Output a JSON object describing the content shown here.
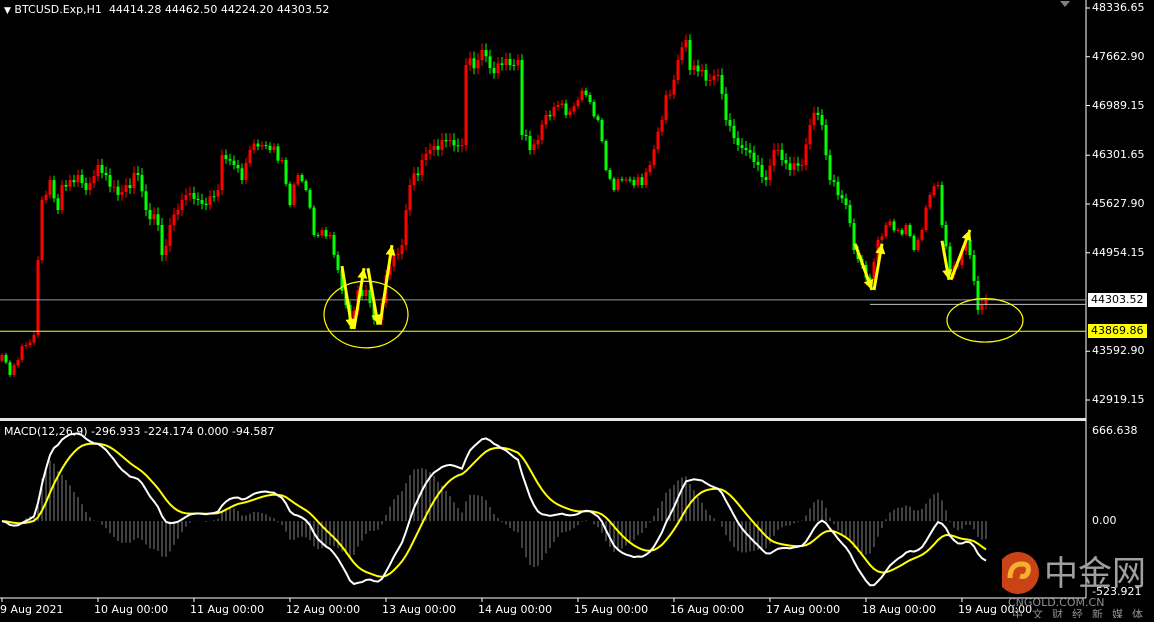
{
  "header": {
    "symbol": "BTCUSD.Exp,H1",
    "ohlc": "44414.28 44462.50 44224.20 44303.52"
  },
  "macd_header": {
    "label": "MACD(12,26,9)",
    "values": "-296.933 -224.174 0.000 -94.587"
  },
  "price_axis": [
    "48336.65",
    "47662.90",
    "46989.15",
    "46301.65",
    "45627.90",
    "44954.15",
    "43592.90",
    "42919.15"
  ],
  "macd_axis": [
    "666.638",
    "0.00",
    "-523.921"
  ],
  "time_axis": [
    "9 Aug 2021",
    "10 Aug 00:00",
    "11 Aug 00:00",
    "12 Aug 00:00",
    "13 Aug 00:00",
    "14 Aug 00:00",
    "15 Aug 00:00",
    "16 Aug 00:00",
    "17 Aug 00:00",
    "18 Aug 00:00",
    "19 Aug 00:00"
  ],
  "current_price": "44303.52",
  "level_line": "43869.86",
  "colors": {
    "background": "#000000",
    "up_candle": "#ff0000",
    "down_candle": "#00ff00",
    "macd_main": "#ffffff",
    "macd_signal": "#ffff00",
    "histogram": "#808080",
    "level": "#ffff00",
    "price_line": "#8c9aa8"
  },
  "watermark": {
    "name": "中金网",
    "domain": "CNGOLD.COM.CN",
    "slogan": "中文财经新媒体"
  },
  "chart_data": {
    "type": "candlestick",
    "timeframe": "H1",
    "ylim": [
      42919.15,
      48336.65
    ],
    "grid": false,
    "closes": [
      [
        "2021-08-09 00:00",
        43541
      ],
      [
        "2021-08-09 02:00",
        43265
      ],
      [
        "2021-08-09 04:00",
        43472
      ],
      [
        "2021-08-09 06:00",
        43679
      ],
      [
        "2021-08-09 08:00",
        43818
      ],
      [
        "2021-08-09 09:00",
        44854
      ],
      [
        "2021-08-09 10:00",
        45683
      ],
      [
        "2021-08-09 12:00",
        45959
      ],
      [
        "2021-08-09 14:00",
        45545
      ],
      [
        "2021-08-09 15:00",
        45890
      ],
      [
        "2021-08-09 17:00",
        45959
      ],
      [
        "2021-08-09 19:00",
        46029
      ],
      [
        "2021-08-09 21:00",
        45821
      ],
      [
        "2021-08-10 00:00",
        46167
      ],
      [
        "2021-08-10 02:00",
        46029
      ],
      [
        "2021-08-10 05:00",
        45752
      ],
      [
        "2021-08-10 07:00",
        45890
      ],
      [
        "2021-08-10 10:00",
        46029
      ],
      [
        "2021-08-10 12:00",
        45545
      ],
      [
        "2021-08-10 15:00",
        45338
      ],
      [
        "2021-08-10 16:00",
        44923
      ],
      [
        "2021-08-10 18:00",
        45338
      ],
      [
        "2021-08-10 20:00",
        45545
      ],
      [
        "2021-08-10 22:00",
        45752
      ],
      [
        "2021-08-11 01:00",
        45683
      ],
      [
        "2021-08-11 03:00",
        45614
      ],
      [
        "2021-08-11 06:00",
        45821
      ],
      [
        "2021-08-11 07:00",
        46305
      ],
      [
        "2021-08-11 10:00",
        46167
      ],
      [
        "2021-08-11 12:00",
        45959
      ],
      [
        "2021-08-11 14:00",
        46374
      ],
      [
        "2021-08-11 17:00",
        46443
      ],
      [
        "2021-08-11 19:00",
        46374
      ],
      [
        "2021-08-11 22:00",
        46236
      ],
      [
        "2021-08-12 00:00",
        45614
      ],
      [
        "2021-08-12 02:00",
        46029
      ],
      [
        "2021-08-12 04:00",
        45821
      ],
      [
        "2021-08-12 06:00",
        45199
      ],
      [
        "2021-08-12 08:00",
        45268
      ],
      [
        "2021-08-12 10:00",
        45199
      ],
      [
        "2021-08-12 12:00",
        44716
      ],
      [
        "2021-08-12 14:00",
        44232
      ],
      [
        "2021-08-12 15:00",
        43956
      ],
      [
        "2021-08-12 17:00",
        44439
      ],
      [
        "2021-08-12 19:00",
        44439
      ],
      [
        "2021-08-12 21:00",
        44025
      ],
      [
        "2021-08-12 22:00",
        44025
      ],
      [
        "2021-08-13 00:00",
        44647
      ],
      [
        "2021-08-13 02:00",
        44923
      ],
      [
        "2021-08-13 04:00",
        45061
      ],
      [
        "2021-08-13 06:00",
        45890
      ],
      [
        "2021-08-13 09:00",
        46236
      ],
      [
        "2021-08-13 11:00",
        46374
      ],
      [
        "2021-08-13 14:00",
        46512
      ],
      [
        "2021-08-13 16:00",
        46512
      ],
      [
        "2021-08-13 19:00",
        46443
      ],
      [
        "2021-08-13 20:00",
        47549
      ],
      [
        "2021-08-13 23:00",
        47618
      ],
      [
        "2021-08-14 00:00",
        47756
      ],
      [
        "2021-08-14 02:00",
        47507
      ],
      [
        "2021-08-14 05:00",
        47549
      ],
      [
        "2021-08-14 07:00",
        47549
      ],
      [
        "2021-08-14 09:00",
        47618
      ],
      [
        "2021-08-14 10:00",
        46582
      ],
      [
        "2021-08-14 12:00",
        46374
      ],
      [
        "2021-08-14 14:00",
        46512
      ],
      [
        "2021-08-14 16:00",
        46858
      ],
      [
        "2021-08-14 19:00",
        46996
      ],
      [
        "2021-08-14 21:00",
        46858
      ],
      [
        "2021-08-15 00:00",
        47065
      ],
      [
        "2021-08-15 02:00",
        47134
      ],
      [
        "2021-08-15 05:00",
        46789
      ],
      [
        "2021-08-15 07:00",
        46098
      ],
      [
        "2021-08-15 09:00",
        45821
      ],
      [
        "2021-08-15 11:00",
        45959
      ],
      [
        "2021-08-15 13:00",
        45959
      ],
      [
        "2021-08-15 16:00",
        45890
      ],
      [
        "2021-08-15 18:00",
        46167
      ],
      [
        "2021-08-15 21:00",
        46789
      ],
      [
        "2021-08-15 22:00",
        47134
      ],
      [
        "2021-08-16 00:00",
        47342
      ],
      [
        "2021-08-16 01:00",
        47618
      ],
      [
        "2021-08-16 03:00",
        47894
      ],
      [
        "2021-08-16 04:00",
        47480
      ],
      [
        "2021-08-16 07:00",
        47480
      ],
      [
        "2021-08-16 09:00",
        47342
      ],
      [
        "2021-08-16 11:00",
        47411
      ],
      [
        "2021-08-16 13:00",
        46789
      ],
      [
        "2021-08-16 16:00",
        46443
      ],
      [
        "2021-08-16 18:00",
        46374
      ],
      [
        "2021-08-16 21:00",
        46167
      ],
      [
        "2021-08-16 23:00",
        45959
      ],
      [
        "2021-08-17 01:00",
        46374
      ],
      [
        "2021-08-17 03:00",
        46236
      ],
      [
        "2021-08-17 05:00",
        46098
      ],
      [
        "2021-08-17 08:00",
        46167
      ],
      [
        "2021-08-17 10:00",
        46720
      ],
      [
        "2021-08-17 12:00",
        46858
      ],
      [
        "2021-08-17 13:00",
        46720
      ],
      [
        "2021-08-17 15:00",
        45959
      ],
      [
        "2021-08-17 17:00",
        45752
      ],
      [
        "2021-08-17 19:00",
        45614
      ],
      [
        "2021-08-17 21:00",
        44992
      ],
      [
        "2021-08-17 23:00",
        44785
      ],
      [
        "2021-08-18 01:00",
        44578
      ],
      [
        "2021-08-18 03:00",
        45130
      ],
      [
        "2021-08-18 05:00",
        45338
      ],
      [
        "2021-08-18 08:00",
        45268
      ],
      [
        "2021-08-18 10:00",
        45338
      ],
      [
        "2021-08-18 12:00",
        44992
      ],
      [
        "2021-08-18 14:00",
        45268
      ],
      [
        "2021-08-18 16:00",
        45752
      ],
      [
        "2021-08-18 18:00",
        45890
      ],
      [
        "2021-08-18 19:00",
        45338
      ],
      [
        "2021-08-18 21:00",
        44647
      ],
      [
        "2021-08-18 23:00",
        44785
      ],
      [
        "2021-08-19 01:00",
        45130
      ],
      [
        "2021-08-19 02:00",
        44923
      ],
      [
        "2021-08-19 04:00",
        44163
      ],
      [
        "2021-08-19 05:00",
        44232
      ],
      [
        "2021-08-19 06:00",
        44303.52
      ]
    ],
    "horizontal_lines": [
      44303.52,
      43869.86
    ],
    "annotations": {
      "arrows": [
        [
          [
            "2021-08-12 13:00",
            44770
          ],
          [
            "2021-08-12 15:30",
            43900
          ]
        ],
        [
          [
            "2021-08-12 16:00",
            43900
          ],
          [
            "2021-08-12 18:30",
            44740
          ]
        ],
        [
          [
            "2021-08-12 19:30",
            44740
          ],
          [
            "2021-08-12 22:00",
            43960
          ]
        ],
        [
          [
            "2021-08-12 22:30",
            43960
          ],
          [
            "2021-08-13 01:30",
            45060
          ]
        ],
        [
          [
            "2021-08-17 21:15",
            45080
          ],
          [
            "2021-08-18 01:30",
            44440
          ]
        ],
        [
          [
            "2021-08-18 02:00",
            44440
          ],
          [
            "2021-08-18 04:00",
            45080
          ]
        ],
        [
          [
            "2021-08-18 19:00",
            45120
          ],
          [
            "2021-08-18 20:45",
            44580
          ]
        ],
        [
          [
            "2021-08-18 21:15",
            44580
          ],
          [
            "2021-08-19 02:00",
            45270
          ]
        ]
      ],
      "ellipses": [
        {
          "center": [
            "2021-08-12 19:00",
            44100
          ],
          "time_radius_hours": 10.5,
          "price_radius": 460
        },
        {
          "center": [
            "2021-08-19 05:45",
            44020
          ],
          "time_radius_hours": 9.5,
          "price_radius": 300
        }
      ]
    },
    "indicator": {
      "name": "MACD",
      "params": [
        12,
        26,
        9
      ],
      "ylim": [
        -523.921,
        666.638
      ]
    }
  }
}
